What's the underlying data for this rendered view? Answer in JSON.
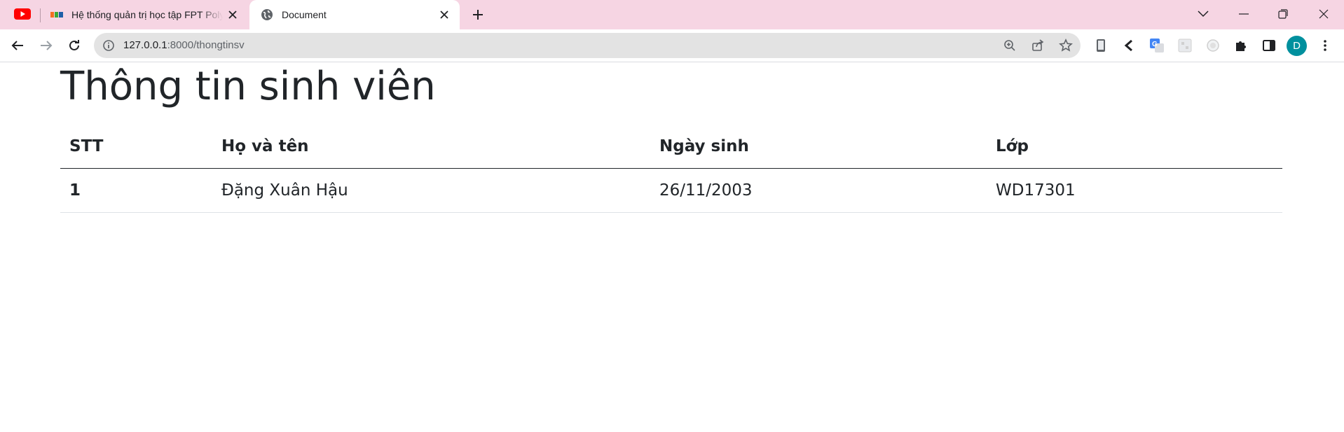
{
  "browser": {
    "tabs": [
      {
        "title": "Hệ thống quản trị học tập FPT Polytechnic",
        "active": false
      },
      {
        "title": "Document",
        "active": true
      }
    ],
    "address_bar": {
      "host": "127.0.0.1",
      "path": ":8000/thongtinsv"
    },
    "profile_initial": "D"
  },
  "page": {
    "title": "Thông tin sinh viên",
    "table": {
      "headers": [
        "STT",
        "Họ và tên",
        "Ngày sinh",
        "Lớp"
      ],
      "rows": [
        [
          "1",
          "Đặng Xuân Hậu",
          "26/11/2003",
          "WD17301"
        ]
      ]
    }
  }
}
